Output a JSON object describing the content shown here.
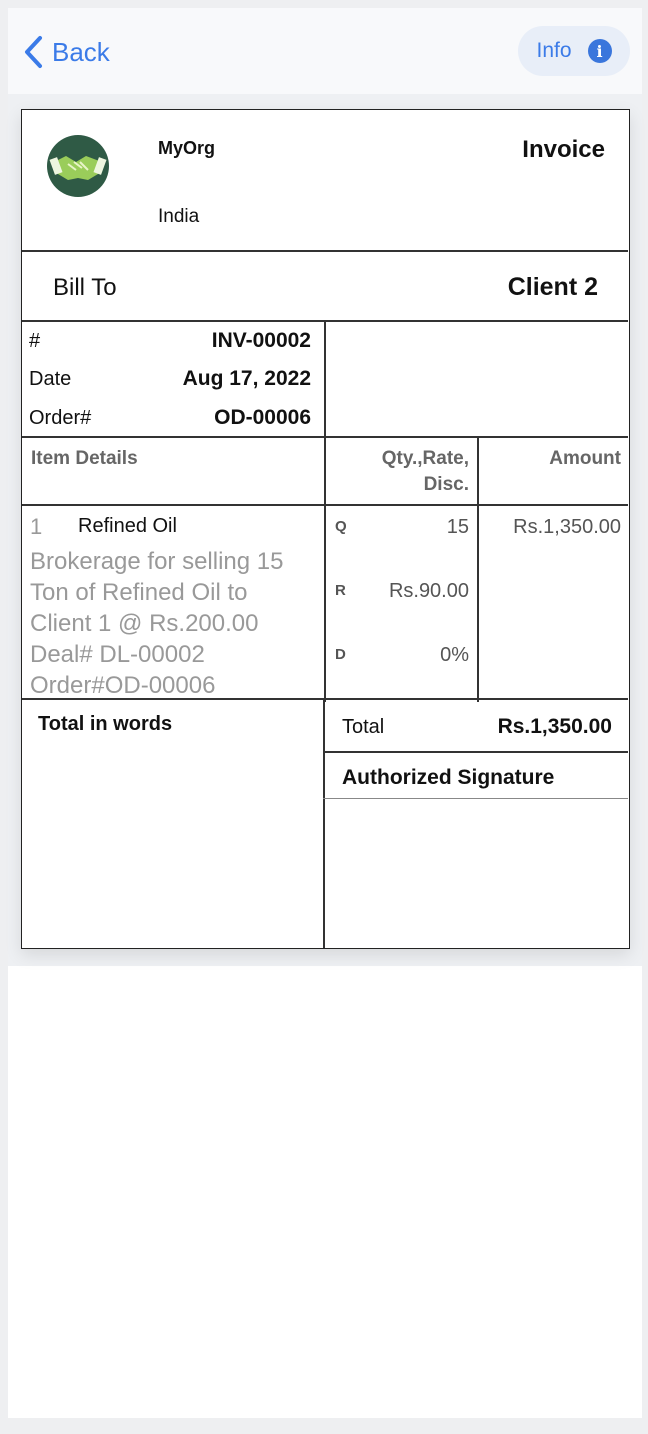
{
  "nav": {
    "back_label": "Back",
    "info_label": "Info"
  },
  "invoice": {
    "org_name": "MyOrg",
    "org_country": "India",
    "title": "Invoice",
    "bill_to_label": "Bill To",
    "client": "Client 2",
    "meta": [
      {
        "label": "#",
        "value": "INV-00002"
      },
      {
        "label": "Date",
        "value": "Aug 17, 2022"
      },
      {
        "label": "Order#",
        "value": "OD-00006"
      }
    ],
    "table_headers": {
      "item": "Item Details",
      "qty_line1": "Qty.,Rate,",
      "qty_line2": "Disc.",
      "amount": "Amount"
    },
    "items": [
      {
        "index": "1",
        "name": "Refined Oil",
        "description_lines": [
          "Brokerage for selling 15",
          "Ton of Refined Oil to",
          "Client 1 @ Rs.200.00",
          "Deal# DL-00002",
          "Order#OD-00006"
        ],
        "q_label": "Q",
        "q_value": "15",
        "r_label": "R",
        "r_value": "Rs.90.00",
        "d_label": "D",
        "d_value": "0%",
        "amount": "Rs.1,350.00"
      }
    ],
    "total_in_words_label": "Total in words",
    "total_label": "Total",
    "total_value": "Rs.1,350.00",
    "signature_label": "Authorized Signature"
  },
  "colors": {
    "accent": "#3b7be8",
    "logo_bg": "#2f5a45",
    "logo_hands": "#9acd5a"
  },
  "icons": {
    "back": "chevron-left-icon",
    "info": "info-circle-icon",
    "logo": "handshake-logo"
  }
}
